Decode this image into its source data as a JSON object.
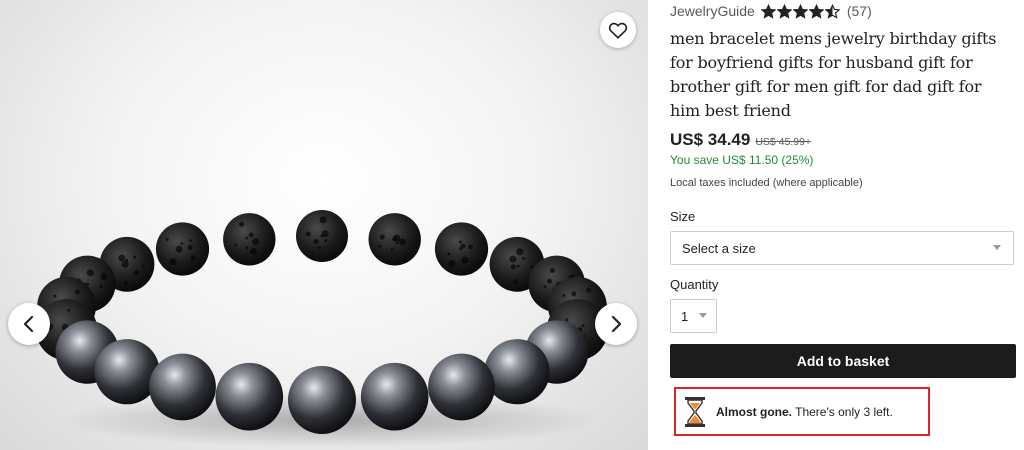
{
  "gallery": {
    "favorite_icon": "heart-outline-icon",
    "prev_icon": "chevron-left-icon",
    "next_icon": "chevron-right-icon"
  },
  "listing": {
    "shop_name": "JewelryGuide",
    "rating": 4.5,
    "rating_max": 5,
    "review_count": "(57)",
    "title": "men bracelet mens jewelry birthday gifts for boyfriend gifts for husband gift for brother gift for men gift for dad gift for him best friend",
    "price": "US$ 34.49",
    "original_price": "US$ 45.99+",
    "savings": "You save US$ 11.50 (25%)",
    "tax_note": "Local taxes included (where applicable)"
  },
  "options": {
    "size_label": "Size",
    "size_value": "Select a size",
    "quantity_label": "Quantity",
    "quantity_value": "1"
  },
  "actions": {
    "add_to_basket": "Add to basket"
  },
  "stock_notice": {
    "bold": "Almost gone.",
    "text": " There's only 3 left.",
    "icon": "hourglass-icon"
  },
  "colors": {
    "savings_green": "#258635",
    "button_dark": "#1c1c1c",
    "highlight_red": "#d9262e",
    "hourglass_orange": "#f1892d"
  }
}
